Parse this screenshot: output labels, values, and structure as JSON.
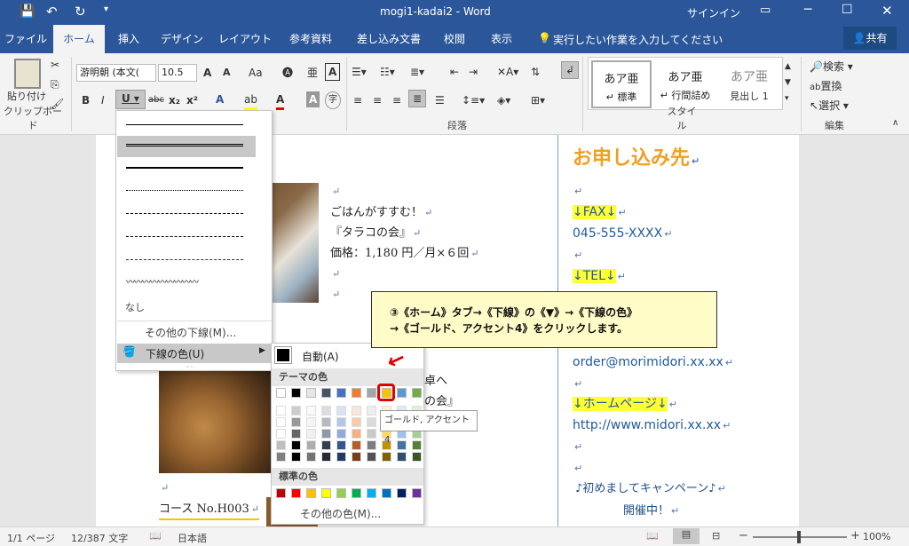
{
  "titlebar": {
    "title": "mogi1-kadai2  -  Word",
    "signin": "サインイン"
  },
  "tabs": [
    "ファイル",
    "ホーム",
    "挿入",
    "デザイン",
    "レイアウト",
    "参考資料",
    "差し込み文書",
    "校閲",
    "表示"
  ],
  "tellme": "実行したい作業を入力してください",
  "share": "共有",
  "ribbon": {
    "paste": "貼り付け",
    "clipboard": "クリップボード",
    "font_name": "游明朝 (本文(",
    "font_size": "10.5",
    "paragraph": "段落",
    "styles": "スタイル",
    "edit": "編集",
    "style_items": [
      {
        "sample": "あア亜",
        "name": "↵ 標準"
      },
      {
        "sample": "あア亜",
        "name": "↵ 行間詰め"
      },
      {
        "sample": "あア亜",
        "name": "見出し 1"
      }
    ],
    "search": "検索",
    "replace": "置換",
    "select": "選択"
  },
  "doc": {
    "left_lines": [
      "ごはんがすすむ！",
      "『タラコの会』",
      "価格：1,180 円／月×６回"
    ],
    "left_partial": [
      "卓へ",
      "の会』"
    ],
    "course": "コース No.H003",
    "right": {
      "heading": "お申し込み先",
      "fax_label": "↓FAX↓",
      "fax": "045-555-XXXX",
      "tel_label": "↓TEL↓",
      "email": "order@morimidori.xx.xx",
      "hp_label": "↓ホームページ↓",
      "hp": "http://www.midori.xx.xx",
      "campaign1": "♪初めましてキャンペーン♪",
      "campaign2": "開催中！"
    }
  },
  "callout": {
    "line1": "③《ホーム》タブ→《下線》の《▼》→《下線の色》",
    "line2": "→《ゴールド、アクセント4》をクリックします。"
  },
  "underline_menu": {
    "none": "なし",
    "other": "その他の下線(M)...",
    "color": "下線の色(U)"
  },
  "color_menu": {
    "auto": "自動(A)",
    "theme": "テーマの色",
    "standard": "標準の色",
    "other": "その他の色(M)...",
    "theme_colors": [
      "#ffffff",
      "#000000",
      "#e7e6e6",
      "#44546a",
      "#4472c4",
      "#ed7d31",
      "#a5a5a5",
      "#ffc000",
      "#5b9bd5",
      "#70ad47"
    ],
    "standard_colors": [
      "#c00000",
      "#ff0000",
      "#ffc000",
      "#ffff00",
      "#92d050",
      "#00b050",
      "#00b0f0",
      "#0070c0",
      "#002060",
      "#7030a0"
    ]
  },
  "tooltip": "ゴールド, アクセント 4",
  "status": {
    "page": "1/1 ページ",
    "words": "12/387 文字",
    "lang": "日本語",
    "zoom": "100%"
  }
}
